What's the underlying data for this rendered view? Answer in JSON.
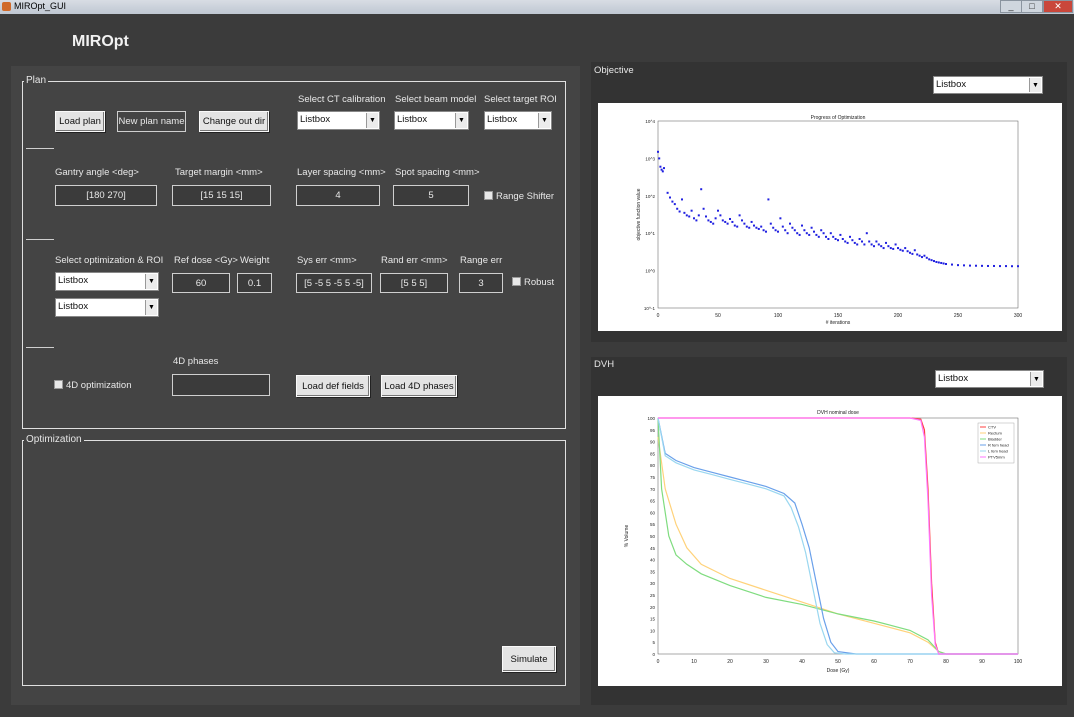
{
  "window": {
    "title": "MIROpt_GUI",
    "minimize": "_",
    "maximize": "□",
    "close": "✕"
  },
  "app": {
    "title": "MIROpt"
  },
  "plan": {
    "legend": "Plan",
    "load_plan": "Load plan",
    "new_plan_name": "New plan name",
    "change_out_dir": "Change out dir",
    "ct_calibration": {
      "label": "Select CT calibration",
      "value": "Listbox"
    },
    "beam_model": {
      "label": "Select beam model",
      "value": "Listbox"
    },
    "target_roi": {
      "label": "Select target ROI",
      "value": "Listbox"
    },
    "gantry": {
      "label": "Gantry  angle <deg>",
      "value": "[180 270]"
    },
    "target_margin": {
      "label": "Target margin <mm>",
      "value": "[15 15 15]"
    },
    "layer_spacing": {
      "label": "Layer spacing <mm>",
      "value": "4"
    },
    "spot_spacing": {
      "label": "Spot spacing <mm>",
      "value": "5"
    },
    "range_shifter": "Range Shifter",
    "select_opt_roi": {
      "label": "Select optimization & ROI",
      "value1": "Listbox",
      "value2": "Listbox"
    },
    "ref_dose": {
      "label": "Ref dose <Gy>",
      "value": "60"
    },
    "weight": {
      "label": "Weight",
      "value": "0.1"
    },
    "sys_err": {
      "label": "Sys err <mm>",
      "value": "[5 -5 5 -5 5 -5]"
    },
    "rand_err": {
      "label": "Rand err <mm>",
      "value": "[5 5 5]"
    },
    "range_err": {
      "label": "Range err",
      "value": "3"
    },
    "robust": "Robust",
    "phases_label": "4D phases",
    "phases_value": "",
    "opt_4d": "4D optimization",
    "load_def_fields": "Load def fields",
    "load_4d_phases": "Load 4D phases"
  },
  "optimization": {
    "legend": "Optimization",
    "simulate": "Simulate"
  },
  "objective": {
    "title": "Objective",
    "listbox": "Listbox"
  },
  "dvh": {
    "title": "DVH",
    "listbox": "Listbox"
  },
  "chart_data": [
    {
      "type": "scatter",
      "title": "Progress of Optimization",
      "xlabel": "# iterations",
      "ylabel": "objective function value",
      "xlim": [
        0,
        300
      ],
      "y_scale": "log",
      "ylim_exponents": [
        -1,
        4
      ],
      "x_ticks": [
        "0",
        "50",
        "100",
        "150",
        "200",
        "250",
        "300"
      ],
      "y_ticks": [
        "10^4",
        "10^3",
        "10^2",
        "10^1",
        "10^0",
        "10^-1"
      ],
      "color": "#2020e0",
      "points": [
        [
          0,
          1500
        ],
        [
          1,
          1000
        ],
        [
          2,
          600
        ],
        [
          3,
          500
        ],
        [
          4,
          450
        ],
        [
          5,
          550
        ],
        [
          8,
          120
        ],
        [
          10,
          90
        ],
        [
          12,
          70
        ],
        [
          14,
          60
        ],
        [
          16,
          45
        ],
        [
          18,
          38
        ],
        [
          20,
          80
        ],
        [
          22,
          35
        ],
        [
          24,
          30
        ],
        [
          26,
          28
        ],
        [
          28,
          40
        ],
        [
          30,
          25
        ],
        [
          32,
          22
        ],
        [
          34,
          30
        ],
        [
          36,
          150
        ],
        [
          38,
          45
        ],
        [
          40,
          28
        ],
        [
          42,
          22
        ],
        [
          44,
          20
        ],
        [
          46,
          18
        ],
        [
          48,
          25
        ],
        [
          50,
          40
        ],
        [
          52,
          30
        ],
        [
          54,
          22
        ],
        [
          56,
          20
        ],
        [
          58,
          18
        ],
        [
          60,
          24
        ],
        [
          62,
          20
        ],
        [
          64,
          16
        ],
        [
          66,
          15
        ],
        [
          68,
          30
        ],
        [
          70,
          22
        ],
        [
          72,
          18
        ],
        [
          74,
          15
        ],
        [
          76,
          14
        ],
        [
          78,
          20
        ],
        [
          80,
          16
        ],
        [
          82,
          14
        ],
        [
          84,
          13
        ],
        [
          86,
          15
        ],
        [
          88,
          12
        ],
        [
          90,
          11
        ],
        [
          92,
          80
        ],
        [
          94,
          18
        ],
        [
          96,
          14
        ],
        [
          98,
          12
        ],
        [
          100,
          11
        ],
        [
          102,
          25
        ],
        [
          104,
          15
        ],
        [
          106,
          12
        ],
        [
          108,
          10
        ],
        [
          110,
          18
        ],
        [
          112,
          14
        ],
        [
          114,
          12
        ],
        [
          116,
          10
        ],
        [
          118,
          9
        ],
        [
          120,
          16
        ],
        [
          122,
          12
        ],
        [
          124,
          10
        ],
        [
          126,
          9
        ],
        [
          128,
          14
        ],
        [
          130,
          11
        ],
        [
          132,
          9
        ],
        [
          134,
          8
        ],
        [
          136,
          12
        ],
        [
          138,
          10
        ],
        [
          140,
          8
        ],
        [
          142,
          7
        ],
        [
          144,
          10
        ],
        [
          146,
          8
        ],
        [
          148,
          7
        ],
        [
          150,
          6.5
        ],
        [
          152,
          9
        ],
        [
          154,
          7
        ],
        [
          156,
          6
        ],
        [
          158,
          5.5
        ],
        [
          160,
          8
        ],
        [
          162,
          6.5
        ],
        [
          164,
          5.5
        ],
        [
          166,
          5
        ],
        [
          168,
          7
        ],
        [
          170,
          6
        ],
        [
          172,
          5
        ],
        [
          174,
          10
        ],
        [
          176,
          6
        ],
        [
          178,
          5
        ],
        [
          180,
          4.5
        ],
        [
          182,
          6
        ],
        [
          184,
          5
        ],
        [
          186,
          4.5
        ],
        [
          188,
          4
        ],
        [
          190,
          5.5
        ],
        [
          192,
          4.5
        ],
        [
          194,
          4
        ],
        [
          196,
          3.8
        ],
        [
          198,
          5
        ],
        [
          200,
          4
        ],
        [
          202,
          3.6
        ],
        [
          204,
          3.4
        ],
        [
          206,
          4
        ],
        [
          208,
          3.3
        ],
        [
          210,
          3
        ],
        [
          212,
          2.8
        ],
        [
          214,
          3.5
        ],
        [
          216,
          2.7
        ],
        [
          218,
          2.5
        ],
        [
          220,
          2.3
        ],
        [
          222,
          2.5
        ],
        [
          224,
          2.2
        ],
        [
          226,
          2
        ],
        [
          228,
          1.9
        ],
        [
          230,
          1.8
        ],
        [
          232,
          1.7
        ],
        [
          234,
          1.65
        ],
        [
          236,
          1.6
        ],
        [
          238,
          1.55
        ],
        [
          240,
          1.5
        ],
        [
          245,
          1.45
        ],
        [
          250,
          1.4
        ],
        [
          255,
          1.38
        ],
        [
          260,
          1.36
        ],
        [
          265,
          1.35
        ],
        [
          270,
          1.34
        ],
        [
          275,
          1.33
        ],
        [
          280,
          1.33
        ],
        [
          285,
          1.32
        ],
        [
          290,
          1.32
        ],
        [
          295,
          1.31
        ],
        [
          300,
          1.31
        ]
      ]
    },
    {
      "type": "line",
      "title": "DVH nominal dose",
      "xlabel": "Dose (Gy)",
      "ylabel": "% Volume",
      "xlim": [
        0,
        100
      ],
      "ylim": [
        0,
        100
      ],
      "x_ticks": [
        "0",
        "10",
        "20",
        "30",
        "40",
        "50",
        "60",
        "70",
        "80",
        "90",
        "100"
      ],
      "y_ticks": [
        "0",
        "5",
        "10",
        "15",
        "20",
        "25",
        "30",
        "35",
        "40",
        "45",
        "50",
        "55",
        "60",
        "65",
        "70",
        "75",
        "80",
        "85",
        "90",
        "95",
        "100"
      ],
      "legend_position": "top-right",
      "series": [
        {
          "name": "CTV",
          "color": "#ff4040",
          "points": [
            [
              0,
              100
            ],
            [
              70,
              100
            ],
            [
              73,
              99.5
            ],
            [
              74,
              95
            ],
            [
              75,
              70
            ],
            [
              76,
              30
            ],
            [
              77,
              5
            ],
            [
              78,
              0
            ],
            [
              100,
              0
            ]
          ]
        },
        {
          "name": "Rectum",
          "color": "#ffd27a",
          "points": [
            [
              0,
              92
            ],
            [
              2,
              70
            ],
            [
              5,
              55
            ],
            [
              8,
              45
            ],
            [
              12,
              38
            ],
            [
              20,
              32
            ],
            [
              30,
              27
            ],
            [
              40,
              22
            ],
            [
              50,
              17
            ],
            [
              60,
              13
            ],
            [
              70,
              9
            ],
            [
              75,
              5
            ],
            [
              78,
              1
            ],
            [
              80,
              0
            ],
            [
              100,
              0
            ]
          ]
        },
        {
          "name": "Bladder",
          "color": "#7fdc7f",
          "points": [
            [
              0,
              100
            ],
            [
              1,
              70
            ],
            [
              3,
              50
            ],
            [
              5,
              42
            ],
            [
              8,
              38
            ],
            [
              12,
              34
            ],
            [
              20,
              29
            ],
            [
              30,
              24
            ],
            [
              40,
              21
            ],
            [
              50,
              17
            ],
            [
              60,
              14
            ],
            [
              70,
              10
            ],
            [
              75,
              6
            ],
            [
              78,
              1
            ],
            [
              80,
              0
            ],
            [
              100,
              0
            ]
          ]
        },
        {
          "name": "R fem head",
          "color": "#6aa0ea",
          "points": [
            [
              0,
              100
            ],
            [
              2,
              85
            ],
            [
              5,
              82
            ],
            [
              10,
              79
            ],
            [
              15,
              77
            ],
            [
              20,
              75
            ],
            [
              25,
              73
            ],
            [
              30,
              71
            ],
            [
              35,
              68
            ],
            [
              38,
              64
            ],
            [
              40,
              55
            ],
            [
              42,
              45
            ],
            [
              44,
              30
            ],
            [
              46,
              15
            ],
            [
              48,
              5
            ],
            [
              50,
              1
            ],
            [
              55,
              0
            ],
            [
              100,
              0
            ]
          ]
        },
        {
          "name": "L fem head",
          "color": "#9ad7f0",
          "points": [
            [
              0,
              100
            ],
            [
              2,
              84
            ],
            [
              5,
              81
            ],
            [
              10,
              78
            ],
            [
              15,
              76
            ],
            [
              20,
              74
            ],
            [
              25,
              72
            ],
            [
              30,
              70
            ],
            [
              35,
              67
            ],
            [
              37,
              62
            ],
            [
              39,
              54
            ],
            [
              41,
              43
            ],
            [
              43,
              28
            ],
            [
              45,
              13
            ],
            [
              47,
              4
            ],
            [
              49,
              0.5
            ],
            [
              52,
              0
            ],
            [
              100,
              0
            ]
          ]
        },
        {
          "name": "PTV5mm",
          "color": "#ff77ff",
          "points": [
            [
              0,
              100
            ],
            [
              70,
              100
            ],
            [
              73,
              99
            ],
            [
              74,
              92
            ],
            [
              75,
              65
            ],
            [
              76,
              25
            ],
            [
              77,
              4
            ],
            [
              78,
              0
            ],
            [
              100,
              0
            ]
          ]
        }
      ]
    }
  ]
}
